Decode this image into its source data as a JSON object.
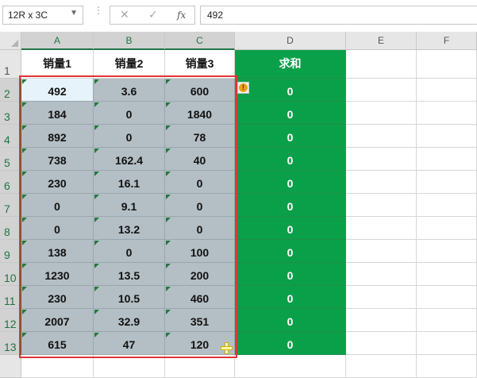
{
  "formula_bar": {
    "name_box": "12R x 3C",
    "cancel_glyph": "✕",
    "enter_glyph": "✓",
    "fx_label": "fx",
    "formula_value": "492"
  },
  "columns": [
    "A",
    "B",
    "C",
    "D",
    "E",
    "F"
  ],
  "rows": [
    "1",
    "2",
    "3",
    "4",
    "5",
    "6",
    "7",
    "8",
    "9",
    "10",
    "11",
    "12",
    "13"
  ],
  "table": {
    "headers": [
      "销量1",
      "销量2",
      "销量3",
      "求和"
    ],
    "data": [
      [
        "492",
        "3.6",
        "600",
        "0"
      ],
      [
        "184",
        "0",
        "1840",
        "0"
      ],
      [
        "892",
        "0",
        "78",
        "0"
      ],
      [
        "738",
        "162.4",
        "40",
        "0"
      ],
      [
        "230",
        "16.1",
        "0",
        "0"
      ],
      [
        "0",
        "9.1",
        "0",
        "0"
      ],
      [
        "0",
        "13.2",
        "0",
        "0"
      ],
      [
        "138",
        "0",
        "100",
        "0"
      ],
      [
        "1230",
        "13.5",
        "200",
        "0"
      ],
      [
        "230",
        "10.5",
        "460",
        "0"
      ],
      [
        "2007",
        "32.9",
        "351",
        "0"
      ],
      [
        "615",
        "47",
        "120",
        "0"
      ]
    ]
  },
  "icons": {
    "error_indicator": "warning-icon",
    "cursor": "plus-cursor-icon"
  },
  "colors": {
    "sum_column": "#0aa04a",
    "selection_outline": "#e03535",
    "selection_fill": "#b4bfc5",
    "excel_green": "#217346"
  }
}
